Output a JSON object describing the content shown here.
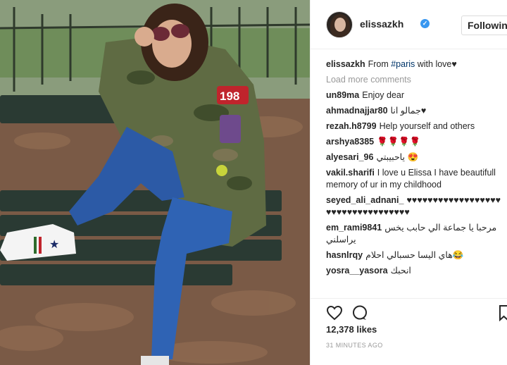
{
  "post": {
    "author": "elissazkh",
    "follow_label": "Following",
    "caption": {
      "user": "elissazkh",
      "text_before": "From ",
      "hashtag": "#paris",
      "text_after": " with love♥"
    },
    "load_more": "Load more comments",
    "comments": [
      {
        "user": "un89ma",
        "text": "Enjoy dear"
      },
      {
        "user": "ahmadnajjar80",
        "text": "جمالو انا♥"
      },
      {
        "user": "rezah.h8799",
        "text": "Help yourself and others"
      },
      {
        "user": "arshya8385",
        "text": "🌹🌹🌹🌹"
      },
      {
        "user": "alyesari_96",
        "text": "ياحبيبتي 😍"
      },
      {
        "user": "vakil.sharifi",
        "text": "I love u Elissa I have beautifull memory of ur in my childhood"
      },
      {
        "user": "seyed_ali_adnani_",
        "text": "♥♥♥♥♥♥♥♥♥♥♥♥♥♥♥♥♥♥♥♥♥♥♥♥♥♥♥♥♥♥♥♥♥♥"
      },
      {
        "user": "em_rami9841",
        "text": "مرحبا يا جماعة الي حابب يخس يراسلني"
      },
      {
        "user": "hasnlrqy",
        "text": "هاي اليسا حسبالي احلام😂"
      },
      {
        "user": "yosra__yasora",
        "text": "انحبك"
      }
    ],
    "likes": "12,378 likes",
    "time": "31 MINUTES AGO",
    "icons": {
      "like": "heart-icon",
      "comment": "comment-icon",
      "save": "bookmark-icon"
    },
    "colors": {
      "link": "#003569",
      "verified": "#3897f0",
      "muted": "#999999"
    }
  }
}
